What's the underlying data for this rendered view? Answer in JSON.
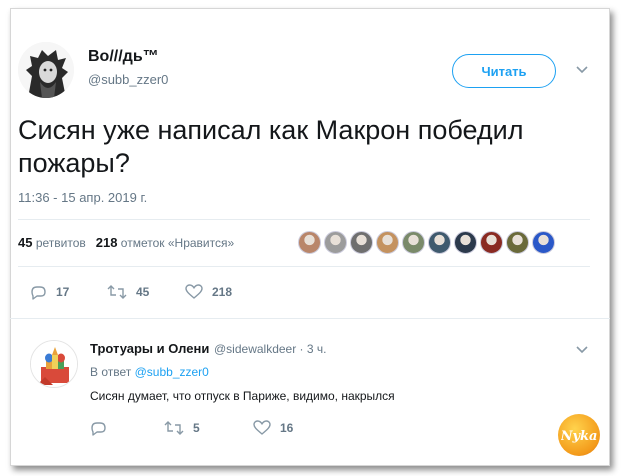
{
  "tweet": {
    "display_name": "Во///дь™",
    "handle": "@subb_zzer0",
    "follow_label": "Читать",
    "text": "Сисян уже написал как Макрон победил пожары?",
    "timestamp": "11:36 - 15 апр. 2019 г.",
    "retweets_count": "45",
    "retweets_label": "ретвитов",
    "likes_count": "218",
    "likes_label": "отметок «Нравится»",
    "actions": {
      "replies": "17",
      "retweets": "45",
      "likes": "218"
    }
  },
  "likers": [
    {
      "color": "#b9866a"
    },
    {
      "color": "#9c9c9c"
    },
    {
      "color": "#6f6f6f"
    },
    {
      "color": "#c4925f"
    },
    {
      "color": "#7a8a6a"
    },
    {
      "color": "#3f5a6e"
    },
    {
      "color": "#2c3a4c"
    },
    {
      "color": "#8a2a22"
    },
    {
      "color": "#6a6a3a"
    },
    {
      "color": "#2a58c8"
    }
  ],
  "reply": {
    "display_name": "Тротуары и Олени",
    "handle_time": "@sidewalkdeer · 3 ч.",
    "in_reply_prefix": "В ответ",
    "in_reply_handle": "@subb_zzer0",
    "text": "Сисян думает, что отпуск в Париже, видимо, накрылся",
    "actions": {
      "replies": "",
      "retweets": "5",
      "likes": "16"
    }
  },
  "colors": {
    "accent": "#1da1f2",
    "secondary_text": "#657786",
    "icon": "#8899a6"
  }
}
